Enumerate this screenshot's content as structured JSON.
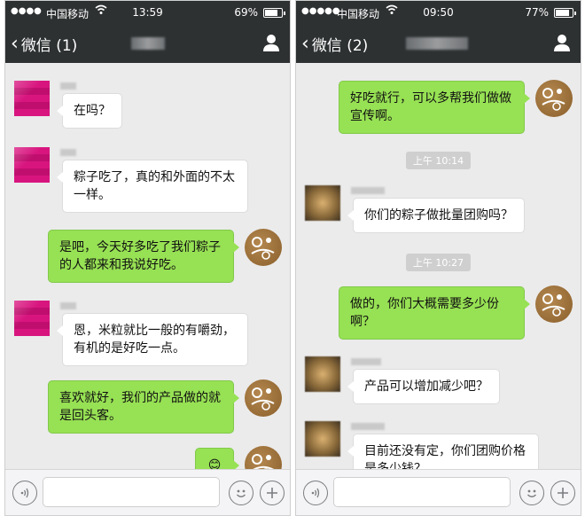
{
  "left": {
    "status": {
      "carrier": "中国移动",
      "time": "13:59",
      "battery": "69%",
      "battery_level": 0.69
    },
    "nav": {
      "back_label": "微信 (1)"
    },
    "messages": [
      {
        "text": "在吗？"
      },
      {
        "text": "粽子吃了，真的和外面的不太一样。"
      },
      {
        "text": "是吧，今天好多吃了我们粽子的人都来和我说好吃。"
      },
      {
        "text": "恩，米粒就比一般的有嚼劲，有机的是好吃一点。"
      },
      {
        "text": "喜欢就好，我们的产品做的就是回头客。"
      },
      {
        "text": "😊"
      }
    ]
  },
  "right": {
    "status": {
      "carrier": "中国移动",
      "time": "09:50",
      "battery": "77%",
      "battery_level": 0.77
    },
    "nav": {
      "back_label": "微信 (2)"
    },
    "messages": [
      {
        "text": "好吃就行，可以多帮我们做做宣传啊。"
      },
      {
        "text": "你们的粽子做批量团购吗？"
      },
      {
        "text": "做的，你们大概需要多少份啊？"
      },
      {
        "text": "产品可以增加减少吧？"
      },
      {
        "text": "目前还没有定，你们团购价格是多少钱？"
      }
    ],
    "timestamps": [
      "上午 10:14",
      "上午 10:27"
    ]
  },
  "icons": {
    "back": "chevron-left-icon",
    "contact": "person-icon",
    "voice": "voice-icon",
    "emoji": "emoji-icon",
    "plus": "plus-icon",
    "wifi": "wifi-icon"
  },
  "colors": {
    "nav_bg": "#2e3132",
    "outgoing_bubble": "#97e154",
    "incoming_bubble": "#ffffff",
    "chat_bg": "#ebebeb"
  }
}
